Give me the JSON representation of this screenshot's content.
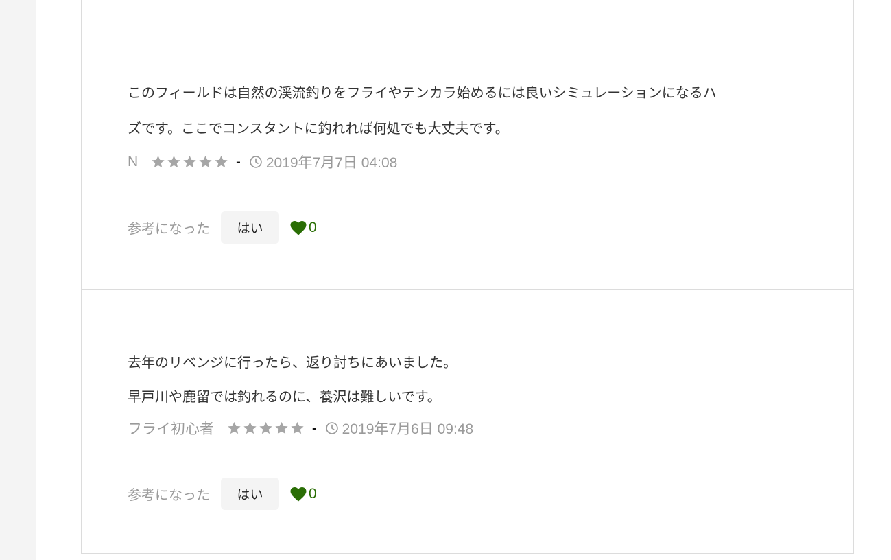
{
  "reviews": [
    {
      "body_lines": [
        "このフィールドは自然の渓流釣りをフライやテンカラ始めるには良いシミュレーションになるハ",
        "ズです。ここでコンスタントに釣れれば何処でも大丈夫です。"
      ],
      "author": "N",
      "rating": 5,
      "separator": "-",
      "date": "2019年7月7日 04:08",
      "helpful_label": "参考になった",
      "yes_label": "はい",
      "likes": "0"
    },
    {
      "body_lines": [
        "去年のリベンジに行ったら、返り討ちにあいました。",
        "早戸川や鹿留では釣れるのに、養沢は難しいです。"
      ],
      "author": "フライ初心者",
      "rating": 5,
      "separator": "-",
      "date": "2019年7月6日 09:48",
      "helpful_label": "参考になった",
      "yes_label": "はい",
      "likes": "0"
    }
  ],
  "colors": {
    "star": "#a6a6a6",
    "heart": "#2a6e05",
    "meta_text": "#9a9a9a",
    "border": "#dcdcdc"
  }
}
